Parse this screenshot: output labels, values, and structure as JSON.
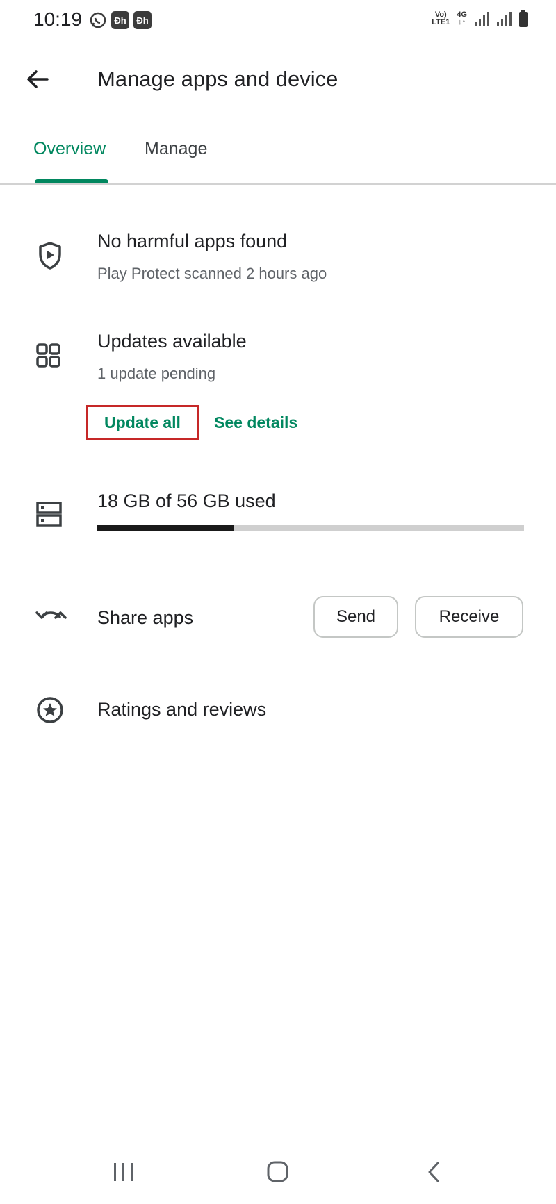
{
  "status_bar": {
    "time": "10:19",
    "notif_badge_1": "Ðh",
    "notif_badge_2": "Ðh",
    "volte": "Vo)",
    "lte": "LTE1",
    "network": "4G"
  },
  "app_bar": {
    "title": "Manage apps and device",
    "back_icon": "arrow-back-icon"
  },
  "tabs": [
    {
      "label": "Overview",
      "selected": true
    },
    {
      "label": "Manage",
      "selected": false
    }
  ],
  "play_protect": {
    "title": "No harmful apps found",
    "subtitle": "Play Protect scanned 2 hours ago",
    "icon": "shield-play-icon"
  },
  "updates": {
    "title": "Updates available",
    "subtitle": "1 update pending",
    "update_all_label": "Update all",
    "see_details_label": "See details",
    "icon": "apps-grid-icon"
  },
  "storage": {
    "label": "18 GB of 56 GB used",
    "used_fraction": 0.32,
    "icon": "storage-icon"
  },
  "share_apps": {
    "label": "Share apps",
    "send_label": "Send",
    "receive_label": "Receive",
    "icon": "share-apps-icon"
  },
  "ratings": {
    "label": "Ratings and reviews",
    "icon": "star-circle-icon"
  },
  "colors": {
    "accent": "#01875f",
    "highlight_box": "#c62828",
    "storage_used": "#1a1a1a",
    "storage_track": "#cfcfcf"
  }
}
